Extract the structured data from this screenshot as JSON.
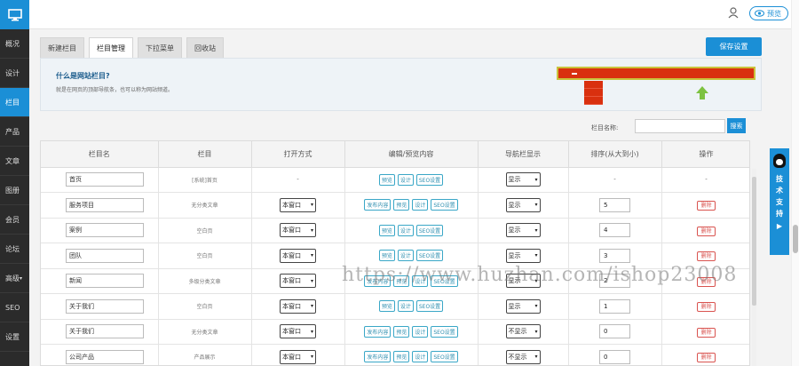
{
  "sidebar": {
    "items": [
      {
        "label": "概况"
      },
      {
        "label": "设计"
      },
      {
        "label": "栏目",
        "active": true
      },
      {
        "label": "产品"
      },
      {
        "label": "文章"
      },
      {
        "label": "图册"
      },
      {
        "label": "会员"
      },
      {
        "label": "论坛"
      },
      {
        "label": "高级"
      },
      {
        "label": "SEO"
      },
      {
        "label": "设置"
      }
    ]
  },
  "header": {
    "preview_label": "预览"
  },
  "tabs": [
    {
      "label": "新建栏目"
    },
    {
      "label": "栏目管理",
      "active": true
    },
    {
      "label": "下拉菜单"
    },
    {
      "label": "回收站"
    }
  ],
  "save_label": "保存设置",
  "info": {
    "question": "什么是网站栏目?",
    "answer": "就是在网页的顶部导航条，也可以称为网站频道。"
  },
  "search": {
    "label": "栏目名称:",
    "button": "搜索",
    "value": ""
  },
  "table": {
    "headers": [
      "栏目名",
      "栏目",
      "打开方式",
      "编辑/预览内容",
      "导航栏显示",
      "排序(从大到小)",
      "操作"
    ],
    "rows": [
      {
        "name": "首页",
        "type": "[系统]首页",
        "open": "-",
        "actions": [
          "预览",
          "设计",
          "SEO设置"
        ],
        "nav": "显示",
        "order": "-",
        "op": "-"
      },
      {
        "name": "服务项目",
        "type": "无分类文章",
        "open": "本窗口",
        "actions": [
          "发布内容",
          "预览",
          "设计",
          "SEO设置"
        ],
        "nav": "显示",
        "order": "5",
        "op": "删除"
      },
      {
        "name": "案例",
        "type": "空白页",
        "open": "本窗口",
        "actions": [
          "预览",
          "设计",
          "SEO设置"
        ],
        "nav": "显示",
        "order": "4",
        "op": "删除"
      },
      {
        "name": "团队",
        "type": "空白页",
        "open": "本窗口",
        "actions": [
          "预览",
          "设计",
          "SEO设置"
        ],
        "nav": "显示",
        "order": "3",
        "op": "删除"
      },
      {
        "name": "新闻",
        "type": "多级分类文章",
        "open": "本窗口",
        "actions": [
          "发布内容",
          "预览",
          "设计",
          "SEO设置"
        ],
        "nav": "显示",
        "order": "2",
        "op": "删除"
      },
      {
        "name": "关于我们",
        "type": "空白页",
        "open": "本窗口",
        "actions": [
          "预览",
          "设计",
          "SEO设置"
        ],
        "nav": "显示",
        "order": "1",
        "op": "删除"
      },
      {
        "name": "关于我们",
        "type": "无分类文章",
        "open": "本窗口",
        "actions": [
          "发布内容",
          "预览",
          "设计",
          "SEO设置"
        ],
        "nav": "不显示",
        "order": "0",
        "op": "删除"
      },
      {
        "name": "公司产品",
        "type": "产品展示",
        "open": "本窗口",
        "actions": [
          "发布内容",
          "预览",
          "设计",
          "SEO设置"
        ],
        "nav": "不显示",
        "order": "0",
        "op": "删除"
      }
    ]
  },
  "support": {
    "label": "技术支持"
  },
  "watermark": "https://www.huzhan.com/ishop23008",
  "colors": {
    "accent": "#1b8fd6",
    "sidebar": "#2b2b2b",
    "danger": "#d9534f"
  }
}
